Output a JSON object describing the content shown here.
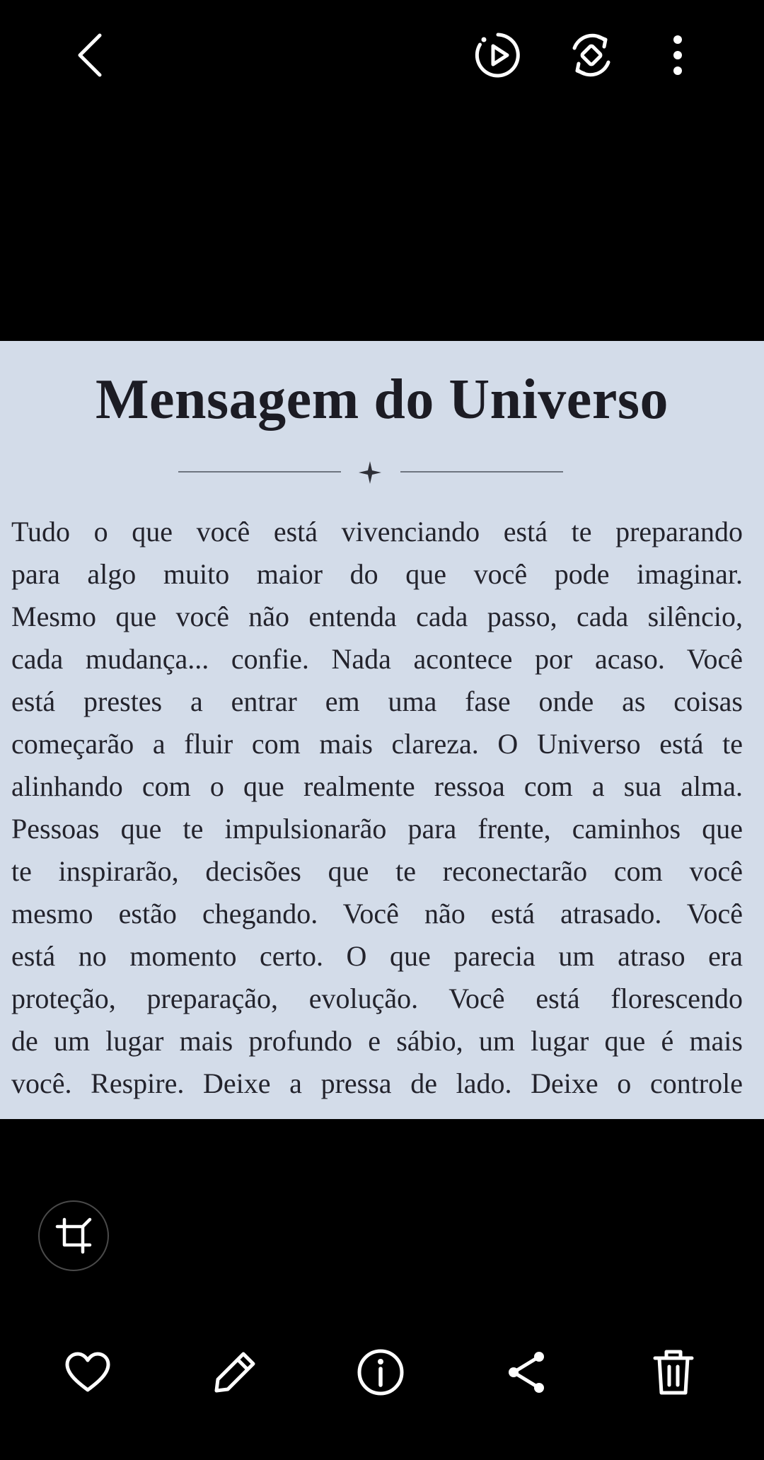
{
  "top_bar": {
    "back_icon": "chevron-left-icon",
    "motion_photo_icon": "play-circle-icon",
    "remaster_icon": "rotate-diamond-icon",
    "more_icon": "more-vertical-icon"
  },
  "photo": {
    "title": "Mensagem do Universo",
    "body_lines": [
      "Tudo o que você está vivenciando está te preparando",
      "para algo muito maior do que você pode imaginar.",
      "Mesmo que você não entenda cada passo, cada silêncio,",
      "cada mudança... confie. Nada acontece por acaso. Você",
      "está prestes a entrar em uma fase onde as coisas",
      "começarão a fluir com mais clareza. O Universo está te",
      "alinhando com o que realmente ressoa com a sua alma.",
      "Pessoas que te impulsionarão para frente, caminhos que",
      "te inspirarão, decisões que te reconectarão com você",
      "mesmo estão chegando. Você não está atrasado. Você",
      "está no momento certo. O que parecia um atraso era",
      "proteção, preparação, evolução. Você está florescendo",
      "de um lugar mais profundo e sábio, um lugar que é mais",
      "você. Respire. Deixe a pressa de lado. Deixe o controle"
    ],
    "background": "#d3dce9"
  },
  "crop_button": {
    "icon": "crop-icon"
  },
  "bottom_bar": {
    "favorite_icon": "heart-icon",
    "edit_icon": "pencil-icon",
    "details_icon": "info-icon",
    "share_icon": "share-icon",
    "delete_icon": "trash-icon"
  }
}
